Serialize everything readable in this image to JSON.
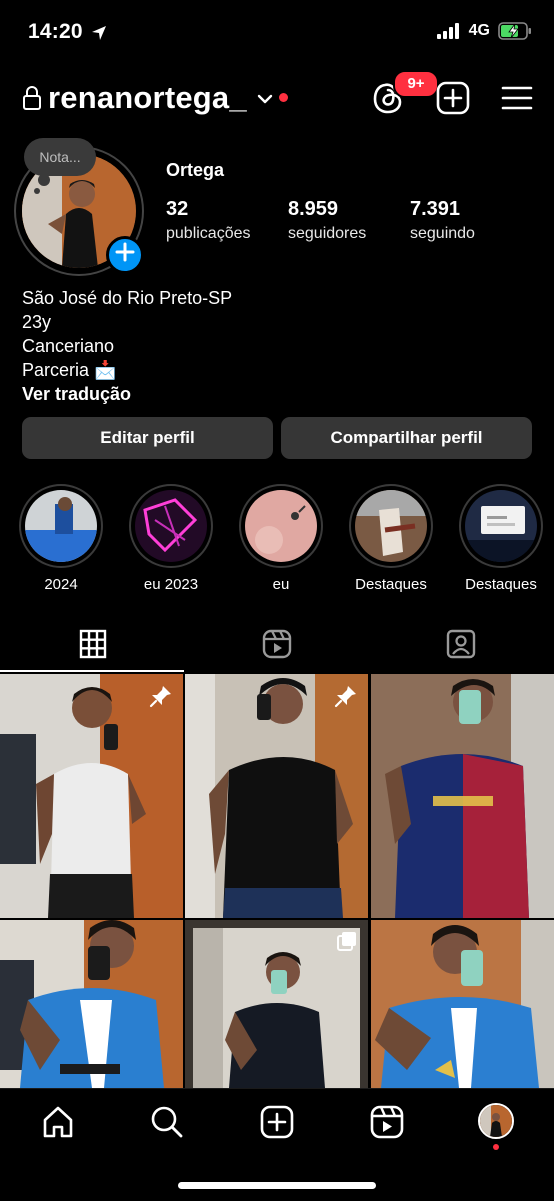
{
  "status_bar": {
    "time": "14:20",
    "network": "4G",
    "icons": [
      "location-arrow-icon",
      "signal-icon",
      "battery-charging-icon"
    ]
  },
  "header": {
    "username": "renanortega_",
    "threads_badge": "9+",
    "icons": [
      "lock-icon",
      "chevron-down-icon",
      "threads-icon",
      "add-post-icon",
      "menu-icon"
    ]
  },
  "profile": {
    "note": "Nota...",
    "display_name": "Ortega",
    "stats": [
      {
        "value": "32",
        "label": "publicações"
      },
      {
        "value": "8.959",
        "label": "seguidores"
      },
      {
        "value": "7.391",
        "label": "seguindo"
      }
    ],
    "bio": [
      "São José do Rio Preto-SP",
      "23y",
      "Canceriano",
      "Parceria 📩"
    ],
    "translate": "Ver tradução"
  },
  "buttons": {
    "edit": "Editar perfil",
    "share": "Compartilhar perfil"
  },
  "highlights": [
    {
      "label": "2024"
    },
    {
      "label": "eu 2023"
    },
    {
      "label": "eu"
    },
    {
      "label": "Destaques"
    },
    {
      "label": "Destaques"
    }
  ],
  "tabs": [
    {
      "name": "grid-icon",
      "active": true
    },
    {
      "name": "reels-icon",
      "active": false
    },
    {
      "name": "tagged-icon",
      "active": false
    }
  ],
  "posts": [
    {
      "pinned": true,
      "type": "photo"
    },
    {
      "pinned": true,
      "type": "photo"
    },
    {
      "pinned": false,
      "type": "photo"
    },
    {
      "pinned": false,
      "type": "photo"
    },
    {
      "pinned": false,
      "type": "carousel"
    },
    {
      "pinned": false,
      "type": "photo"
    }
  ],
  "colors": {
    "background": "#000000",
    "button": "#363636",
    "accent_blue": "#0095f6",
    "notification_red": "#ff3040"
  },
  "bottom_nav": [
    "home-icon",
    "search-icon",
    "create-icon",
    "reels-icon",
    "profile-avatar"
  ]
}
